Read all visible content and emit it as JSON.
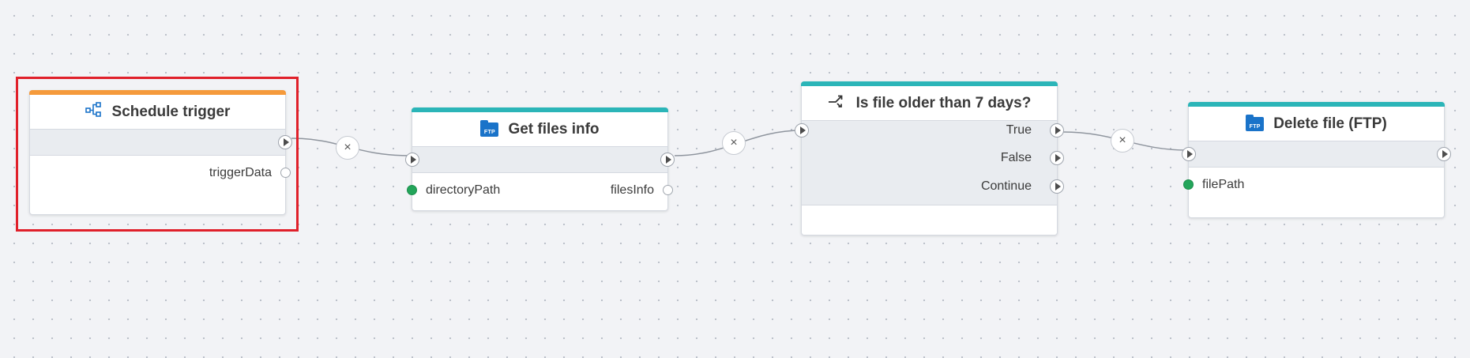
{
  "colors": {
    "trigger_bar": "#f59a3b",
    "action_bar": "#2bb5b8",
    "selection_border": "#e0202a",
    "port_filled": "#23a55a",
    "ftp_icon": "#1a73c9"
  },
  "nodes": {
    "schedule_trigger": {
      "title": "Schedule trigger",
      "icon": "schedule-trigger-icon",
      "outputs": [
        "triggerData"
      ]
    },
    "get_files_info": {
      "title": "Get files info",
      "icon": "ftp-icon",
      "icon_text": "FTP",
      "inputs": [
        "directoryPath"
      ],
      "outputs": [
        "filesInfo"
      ]
    },
    "condition": {
      "title": "Is file older than 7 days?",
      "icon": "branch-icon",
      "branches": [
        "True",
        "False",
        "Continue"
      ]
    },
    "delete_file": {
      "title": "Delete file (FTP)",
      "icon": "ftp-icon",
      "icon_text": "FTP",
      "inputs": [
        "filePath"
      ]
    }
  },
  "connections": [
    {
      "from": "Schedule trigger",
      "to": "Get files info",
      "remove_label": "×"
    },
    {
      "from": "Get files info",
      "to": "Is file older than 7 days?",
      "remove_label": "×"
    },
    {
      "from": "True",
      "to": "Delete file (FTP)",
      "remove_label": "×"
    }
  ]
}
